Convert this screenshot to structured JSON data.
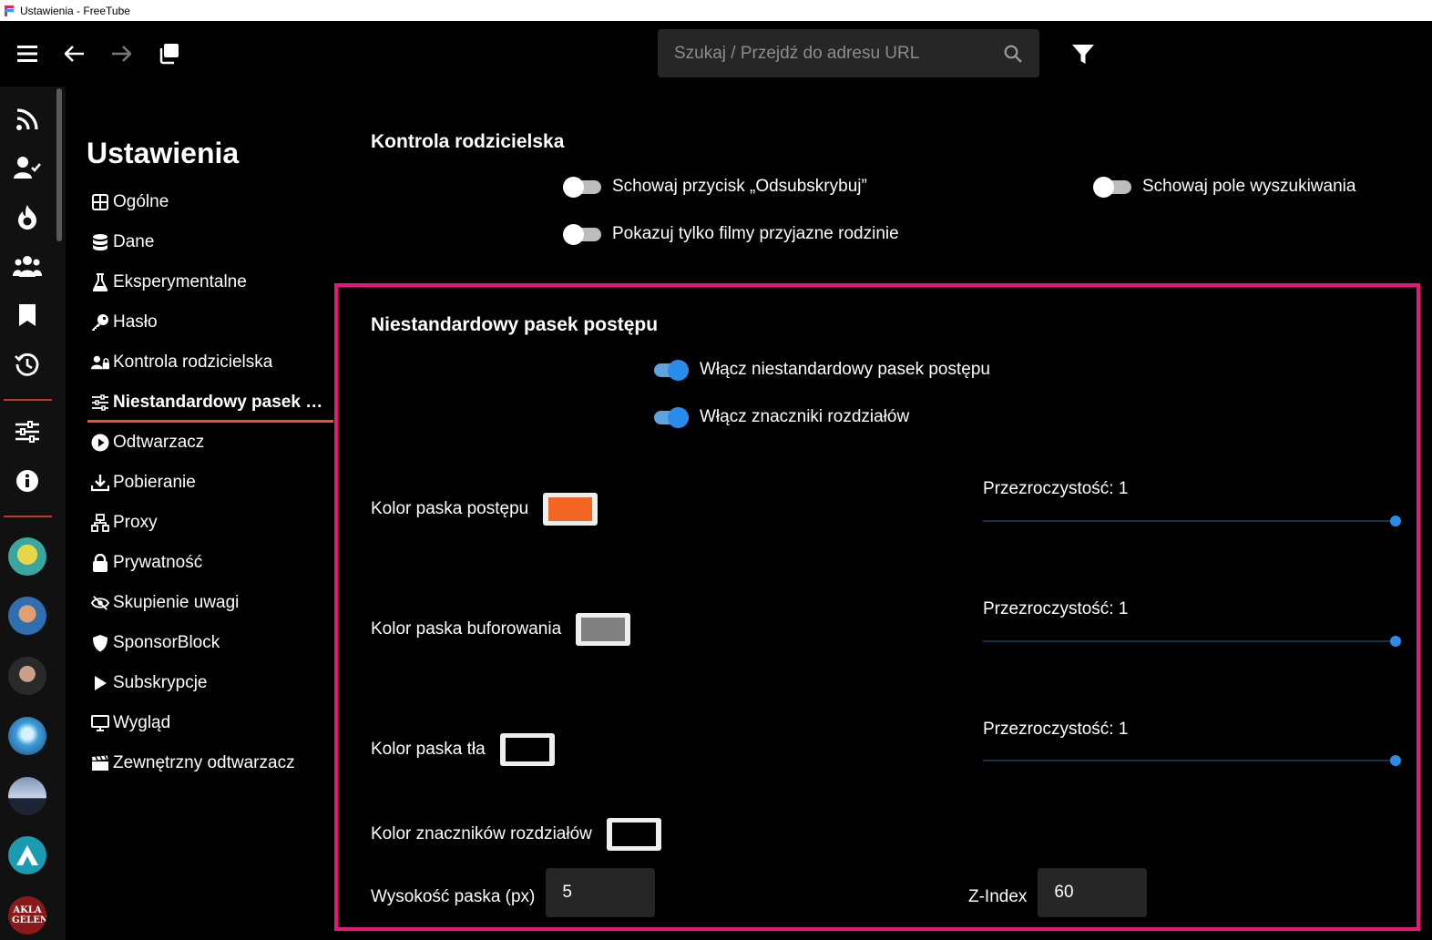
{
  "window": {
    "title": "Ustawienia - FreeTube"
  },
  "topnav": {
    "search_placeholder": "Szukaj / Przejdź do adresu URL",
    "icons": [
      "menu-icon",
      "back-arrow-icon",
      "forward-arrow-icon",
      "new-window-icon",
      "search-icon",
      "filter-icon"
    ]
  },
  "rail": {
    "icons": [
      "rss-icon",
      "user-check-icon",
      "fire-icon",
      "users-icon",
      "bookmark-icon",
      "history-icon",
      "sliders-icon",
      "info-icon"
    ],
    "avatar_text": "AKLA GELEN"
  },
  "settings": {
    "title": "Ustawienia",
    "nav": [
      {
        "label": "Ogólne",
        "icon": "grid-icon"
      },
      {
        "label": "Dane",
        "icon": "database-icon"
      },
      {
        "label": "Eksperymentalne",
        "icon": "flask-icon"
      },
      {
        "label": "Hasło",
        "icon": "key-icon"
      },
      {
        "label": "Kontrola rodzicielska",
        "icon": "user-lock-icon"
      },
      {
        "label": "Niestandardowy pasek po...",
        "icon": "sliders-icon",
        "active": true
      },
      {
        "label": "Odtwarzacz",
        "icon": "play-circle-icon"
      },
      {
        "label": "Pobieranie",
        "icon": "download-icon"
      },
      {
        "label": "Proxy",
        "icon": "network-icon"
      },
      {
        "label": "Prywatność",
        "icon": "lock-icon"
      },
      {
        "label": "Skupienie uwagi",
        "icon": "eye-slash-icon"
      },
      {
        "label": "SponsorBlock",
        "icon": "shield-icon"
      },
      {
        "label": "Subskrypcje",
        "icon": "play-icon"
      },
      {
        "label": "Wygląd",
        "icon": "monitor-icon"
      },
      {
        "label": "Zewnętrzny odtwarzacz",
        "icon": "clapperboard-icon"
      }
    ]
  },
  "parental": {
    "title": "Kontrola rodzicielska",
    "toggles": {
      "hide_unsubscribe": {
        "label": "Schowaj przycisk „Odsubskrybuj”",
        "on": false
      },
      "hide_search": {
        "label": "Schowaj pole wyszukiwania",
        "on": false
      },
      "family_friendly": {
        "label": "Pokazuj tylko filmy przyjazne rodzinie",
        "on": false
      }
    }
  },
  "progressbar": {
    "title": "Niestandardowy pasek postępu",
    "toggles": {
      "enable_custom": {
        "label": "Włącz niestandardowy pasek postępu",
        "on": true
      },
      "enable_chapters": {
        "label": "Włącz znaczniki rozdziałów",
        "on": true
      }
    },
    "progress_color": {
      "label": "Kolor paska postępu",
      "color": "#f26522",
      "opacity_label": "Przezroczystość: 1",
      "opacity": 1
    },
    "buffer_color": {
      "label": "Kolor paska buforowania",
      "color": "#808080",
      "opacity_label": "Przezroczystość: 1",
      "opacity": 1
    },
    "background_color": {
      "label": "Kolor paska tła",
      "color": "#000000",
      "opacity_label": "Przezroczystość: 1",
      "opacity": 1
    },
    "chapter_color": {
      "label": "Kolor znaczników rozdziałów",
      "color": "#000000"
    },
    "height": {
      "label": "Wysokość paska (px)",
      "value": "5"
    },
    "zindex": {
      "label": "Z-Index",
      "value": "60"
    }
  },
  "colors": {
    "accent": "#2a8cea",
    "active_underline": "#f04e23",
    "highlight": "#e8167a"
  }
}
